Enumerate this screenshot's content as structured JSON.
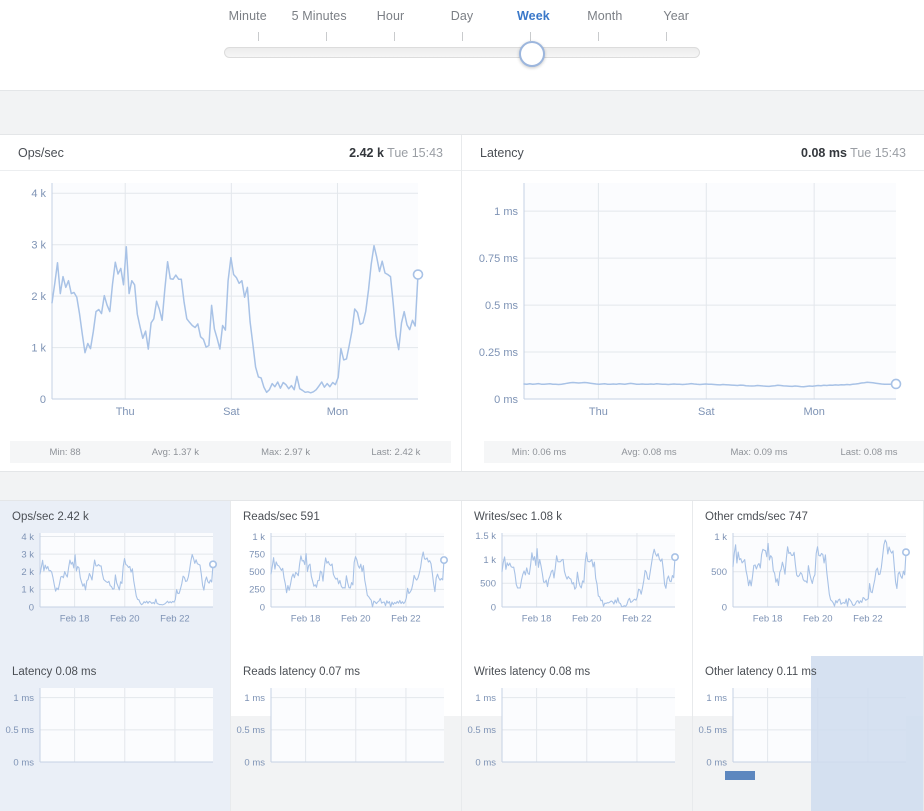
{
  "range_selector": {
    "options": [
      "Minute",
      "5 Minutes",
      "Hour",
      "Day",
      "Week",
      "Month",
      "Year"
    ],
    "selected": "Week",
    "selected_index": 4
  },
  "colors": {
    "line": "#a8c2e6",
    "accent": "#3a78c9",
    "plot_bg": "#fbfcfe",
    "grid": "#e3e7ec",
    "tile_selected_bg": "#eaeff7",
    "hover_overlay": "#cfdcee",
    "hover_bar": "#5d87bf"
  },
  "main_panels": [
    {
      "title": "Ops/sec",
      "readout_value": "2.42 k",
      "readout_time": "Tue 15:43",
      "stats": [
        "Min: 88",
        "Avg: 1.37 k",
        "Max: 2.97 k",
        "Last: 2.42 k"
      ]
    },
    {
      "title": "Latency",
      "readout_value": "0.08 ms",
      "readout_time": "Tue 15:43",
      "stats": [
        "Min: 0.06 ms",
        "Avg: 0.08 ms",
        "Max: 0.09 ms",
        "Last: 0.08 ms"
      ]
    }
  ],
  "tiles": [
    {
      "title": "Ops/sec 2.42 k",
      "selected": true,
      "cut_off": false
    },
    {
      "title": "Reads/sec 591",
      "selected": false,
      "cut_off": false
    },
    {
      "title": "Writes/sec 1.08 k",
      "selected": false,
      "cut_off": false
    },
    {
      "title": "Other cmds/sec 747",
      "selected": false,
      "cut_off": false
    },
    {
      "title": "Latency 0.08 ms",
      "selected": true,
      "cut_off": true
    },
    {
      "title": "Reads latency 0.07 ms",
      "selected": false,
      "cut_off": true
    },
    {
      "title": "Writes latency 0.08 ms",
      "selected": false,
      "cut_off": true
    },
    {
      "title": "Other latency 0.11 ms",
      "selected": false,
      "cut_off": true,
      "hover": true
    }
  ],
  "chart_data": [
    {
      "type": "line",
      "title": "Ops/sec",
      "xlabel": "",
      "ylabel": "",
      "ylim": [
        0,
        4000
      ],
      "yticks": [
        0,
        1000,
        2000,
        3000,
        4000
      ],
      "ytick_labels": [
        "0",
        "1 k",
        "2 k",
        "3 k",
        "4 k"
      ],
      "xtick_labels": [
        "Thu",
        "Sat",
        "Mon"
      ],
      "xtick_positions": [
        0.2,
        0.49,
        0.78
      ],
      "grid": true,
      "last_point_marker": true,
      "last_value": 2420,
      "values": [
        1870,
        2250,
        2650,
        2050,
        2380,
        2170,
        2300,
        2050,
        2070,
        1980,
        1660,
        1260,
        900,
        1080,
        980,
        1310,
        1700,
        1740,
        1660,
        2010,
        1830,
        1700,
        2230,
        2660,
        2430,
        2540,
        2220,
        2960,
        2050,
        2300,
        2220,
        1650,
        1400,
        1180,
        1320,
        970,
        1480,
        1560,
        1900,
        1750,
        1530,
        2130,
        2670,
        2340,
        2330,
        2410,
        2330,
        2330,
        1880,
        1560,
        1490,
        1430,
        1390,
        1460,
        1210,
        1160,
        1010,
        1040,
        1820,
        1360,
        1180,
        970,
        1430,
        1340,
        2300,
        2750,
        2420,
        2360,
        2250,
        2300,
        1980,
        2170,
        1500,
        1060,
        620,
        430,
        410,
        230,
        130,
        180,
        300,
        240,
        330,
        210,
        320,
        280,
        200,
        260,
        180,
        440,
        200,
        170,
        130,
        140,
        120,
        140,
        180,
        250,
        330,
        230,
        300,
        240,
        320,
        280,
        420,
        980,
        760,
        780,
        1040,
        1330,
        1750,
        1680,
        1450,
        1480,
        1700,
        2120,
        2620,
        2980,
        2760,
        2480,
        2680,
        2450,
        2420,
        2380,
        1860,
        1230,
        960,
        1480,
        1700,
        1440,
        1350,
        1530,
        1420,
        2420
      ]
    },
    {
      "type": "line",
      "title": "Latency",
      "xlabel": "",
      "ylabel": "",
      "ylim": [
        0,
        1.15
      ],
      "yticks": [
        0,
        0.25,
        0.5,
        0.75,
        1
      ],
      "ytick_labels": [
        "0 ms",
        "0.25 ms",
        "0.5 ms",
        "0.75 ms",
        "1 ms"
      ],
      "xtick_labels": [
        "Thu",
        "Sat",
        "Mon"
      ],
      "xtick_positions": [
        0.2,
        0.49,
        0.78
      ],
      "grid": true,
      "last_point_marker": true,
      "last_value": 0.08,
      "values": [
        0.08,
        0.079,
        0.081,
        0.078,
        0.08,
        0.082,
        0.079,
        0.078,
        0.08,
        0.081,
        0.079,
        0.078,
        0.077,
        0.079,
        0.081,
        0.084,
        0.086,
        0.088,
        0.087,
        0.085,
        0.086,
        0.088,
        0.086,
        0.084,
        0.082,
        0.08,
        0.079,
        0.08,
        0.081,
        0.079,
        0.078,
        0.08,
        0.079,
        0.081,
        0.08,
        0.079,
        0.081,
        0.083,
        0.081,
        0.079,
        0.078,
        0.08,
        0.079,
        0.078,
        0.08,
        0.079,
        0.081,
        0.08,
        0.079,
        0.078,
        0.077,
        0.079,
        0.08,
        0.079,
        0.078,
        0.077,
        0.078,
        0.08,
        0.082,
        0.08,
        0.078,
        0.077,
        0.079,
        0.08,
        0.079,
        0.078,
        0.077,
        0.076,
        0.075,
        0.077,
        0.076,
        0.075,
        0.074,
        0.073,
        0.072,
        0.074,
        0.073,
        0.071,
        0.07,
        0.069,
        0.07,
        0.072,
        0.071,
        0.069,
        0.068,
        0.067,
        0.069,
        0.071,
        0.073,
        0.072,
        0.07,
        0.069,
        0.068,
        0.067,
        0.069,
        0.068,
        0.066,
        0.065,
        0.067,
        0.069,
        0.068,
        0.07,
        0.072,
        0.071,
        0.073,
        0.072,
        0.074,
        0.073,
        0.075,
        0.074,
        0.076,
        0.075,
        0.077,
        0.076,
        0.078,
        0.08,
        0.082,
        0.085,
        0.087,
        0.089,
        0.088,
        0.086,
        0.084,
        0.082,
        0.08,
        0.079,
        0.078,
        0.079,
        0.08,
        0.08
      ]
    },
    {
      "type": "line",
      "title": "Ops/sec 2.42 k",
      "ylim": [
        0,
        4000
      ],
      "ytick_labels": [
        "0",
        "1 k",
        "2 k",
        "3 k",
        "4 k"
      ],
      "xtick_labels": [
        "Feb 18",
        "Feb 20",
        "Feb 22"
      ],
      "xtick_positions": [
        0.2,
        0.49,
        0.78
      ],
      "last_value": 2420
    },
    {
      "type": "line",
      "title": "Reads/sec 591",
      "ylim": [
        0,
        1000
      ],
      "ytick_labels": [
        "0",
        "250",
        "500",
        "750",
        "1 k"
      ],
      "xtick_labels": [
        "Feb 18",
        "Feb 20",
        "Feb 22"
      ],
      "xtick_positions": [
        0.2,
        0.49,
        0.78
      ],
      "last_value": 591
    },
    {
      "type": "line",
      "title": "Writes/sec 1.08 k",
      "ylim": [
        0,
        1500
      ],
      "ytick_labels": [
        "0",
        "500",
        "1 k",
        "1.5 k"
      ],
      "xtick_labels": [
        "Feb 18",
        "Feb 20",
        "Feb 22"
      ],
      "xtick_positions": [
        0.2,
        0.49,
        0.78
      ],
      "last_value": 1080
    },
    {
      "type": "line",
      "title": "Other cmds/sec 747",
      "ylim": [
        0,
        1000
      ],
      "ytick_labels": [
        "0",
        "500",
        "1 k"
      ],
      "xtick_labels": [
        "Feb 18",
        "Feb 20",
        "Feb 22"
      ],
      "xtick_positions": [
        0.2,
        0.49,
        0.78
      ],
      "last_value": 747
    },
    {
      "type": "line",
      "title": "Latency 0.08 ms",
      "ylim": [
        0,
        1.15
      ],
      "ytick_labels": [
        "0.5 ms",
        "1 ms"
      ],
      "last_value": 0.08
    },
    {
      "type": "line",
      "title": "Reads latency 0.07 ms",
      "ylim": [
        0,
        1.15
      ],
      "ytick_labels": [
        "0.5 ms",
        "1 ms"
      ],
      "last_value": 0.07
    },
    {
      "type": "line",
      "title": "Writes latency 0.08 ms",
      "ylim": [
        0,
        1.15
      ],
      "ytick_labels": [
        "0.5 ms",
        "1 ms"
      ],
      "last_value": 0.08
    },
    {
      "type": "line",
      "title": "Other latency 0.11 ms",
      "ylim": [
        0,
        1.15
      ],
      "ytick_labels": [
        "0.5 ms",
        "1 ms"
      ],
      "last_value": 0.11
    }
  ]
}
